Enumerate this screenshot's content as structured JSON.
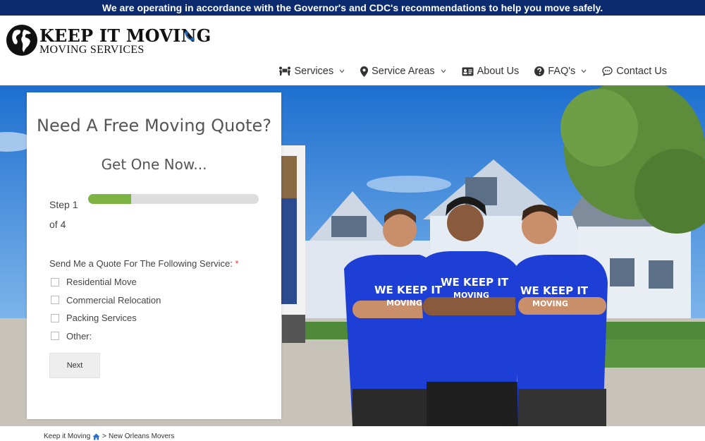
{
  "announcement": "We are operating in accordance with the Governor's and CDC's recommendations to help you move safely.",
  "logo": {
    "title": "KEEP IT MOVING",
    "subtitle": "MOVING SERVICES"
  },
  "nav": {
    "services": "Services",
    "service_areas": "Service Areas",
    "about": "About Us",
    "faqs": "FAQ's",
    "contact": "Contact Us"
  },
  "quote": {
    "heading": "Need A Free Moving Quote?",
    "subheading": "Get One Now...",
    "step_label": "Step 1 of 4",
    "progress": 0.25,
    "question": "Send Me a Quote For The Following Service:",
    "required_mark": "*",
    "options": [
      "Residential Move",
      "Commercial Relocation",
      "Packing Services",
      "Other:"
    ],
    "next_label": "Next"
  },
  "hero": {
    "shirt_text_line1": "WE KEEP IT",
    "shirt_text_line2": "MOVING"
  },
  "breadcrumb": {
    "home": "Keep it Moving",
    "separator": ">",
    "current": "New Orleans Movers"
  },
  "colors": {
    "announce_bg": "#0b2b6e",
    "progress": "#7cb342",
    "phone": "#1a63b8",
    "home_icon": "#2a73c8",
    "shirt": "#1d3fd6"
  }
}
